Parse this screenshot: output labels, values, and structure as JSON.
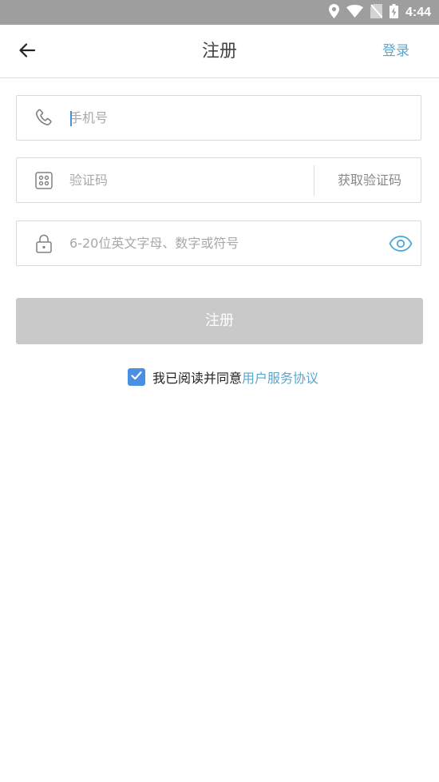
{
  "status_bar": {
    "time": "4:44",
    "icons": [
      "location-icon",
      "wifi-icon",
      "no-sim-icon",
      "battery-charging-icon"
    ]
  },
  "app_bar": {
    "title": "注册",
    "back_icon": "arrow-left-icon",
    "login_label": "登录"
  },
  "form": {
    "phone": {
      "icon": "phone-icon",
      "placeholder": "手机号",
      "value": ""
    },
    "code": {
      "icon": "keypad-icon",
      "placeholder": "验证码",
      "value": "",
      "get_code_label": "获取验证码"
    },
    "password": {
      "icon": "lock-icon",
      "placeholder": "6-20位英文字母、数字或符号",
      "value": "",
      "toggle_icon": "eye-icon"
    },
    "submit_label": "注册"
  },
  "agreement": {
    "checked": true,
    "text": "我已阅读并同意",
    "link": "用户服务协议"
  },
  "colors": {
    "accent": "#5ba6cf",
    "checkbox": "#4a90e2",
    "button_disabled": "#c9c9c9",
    "status_bar": "#9e9e9e"
  }
}
